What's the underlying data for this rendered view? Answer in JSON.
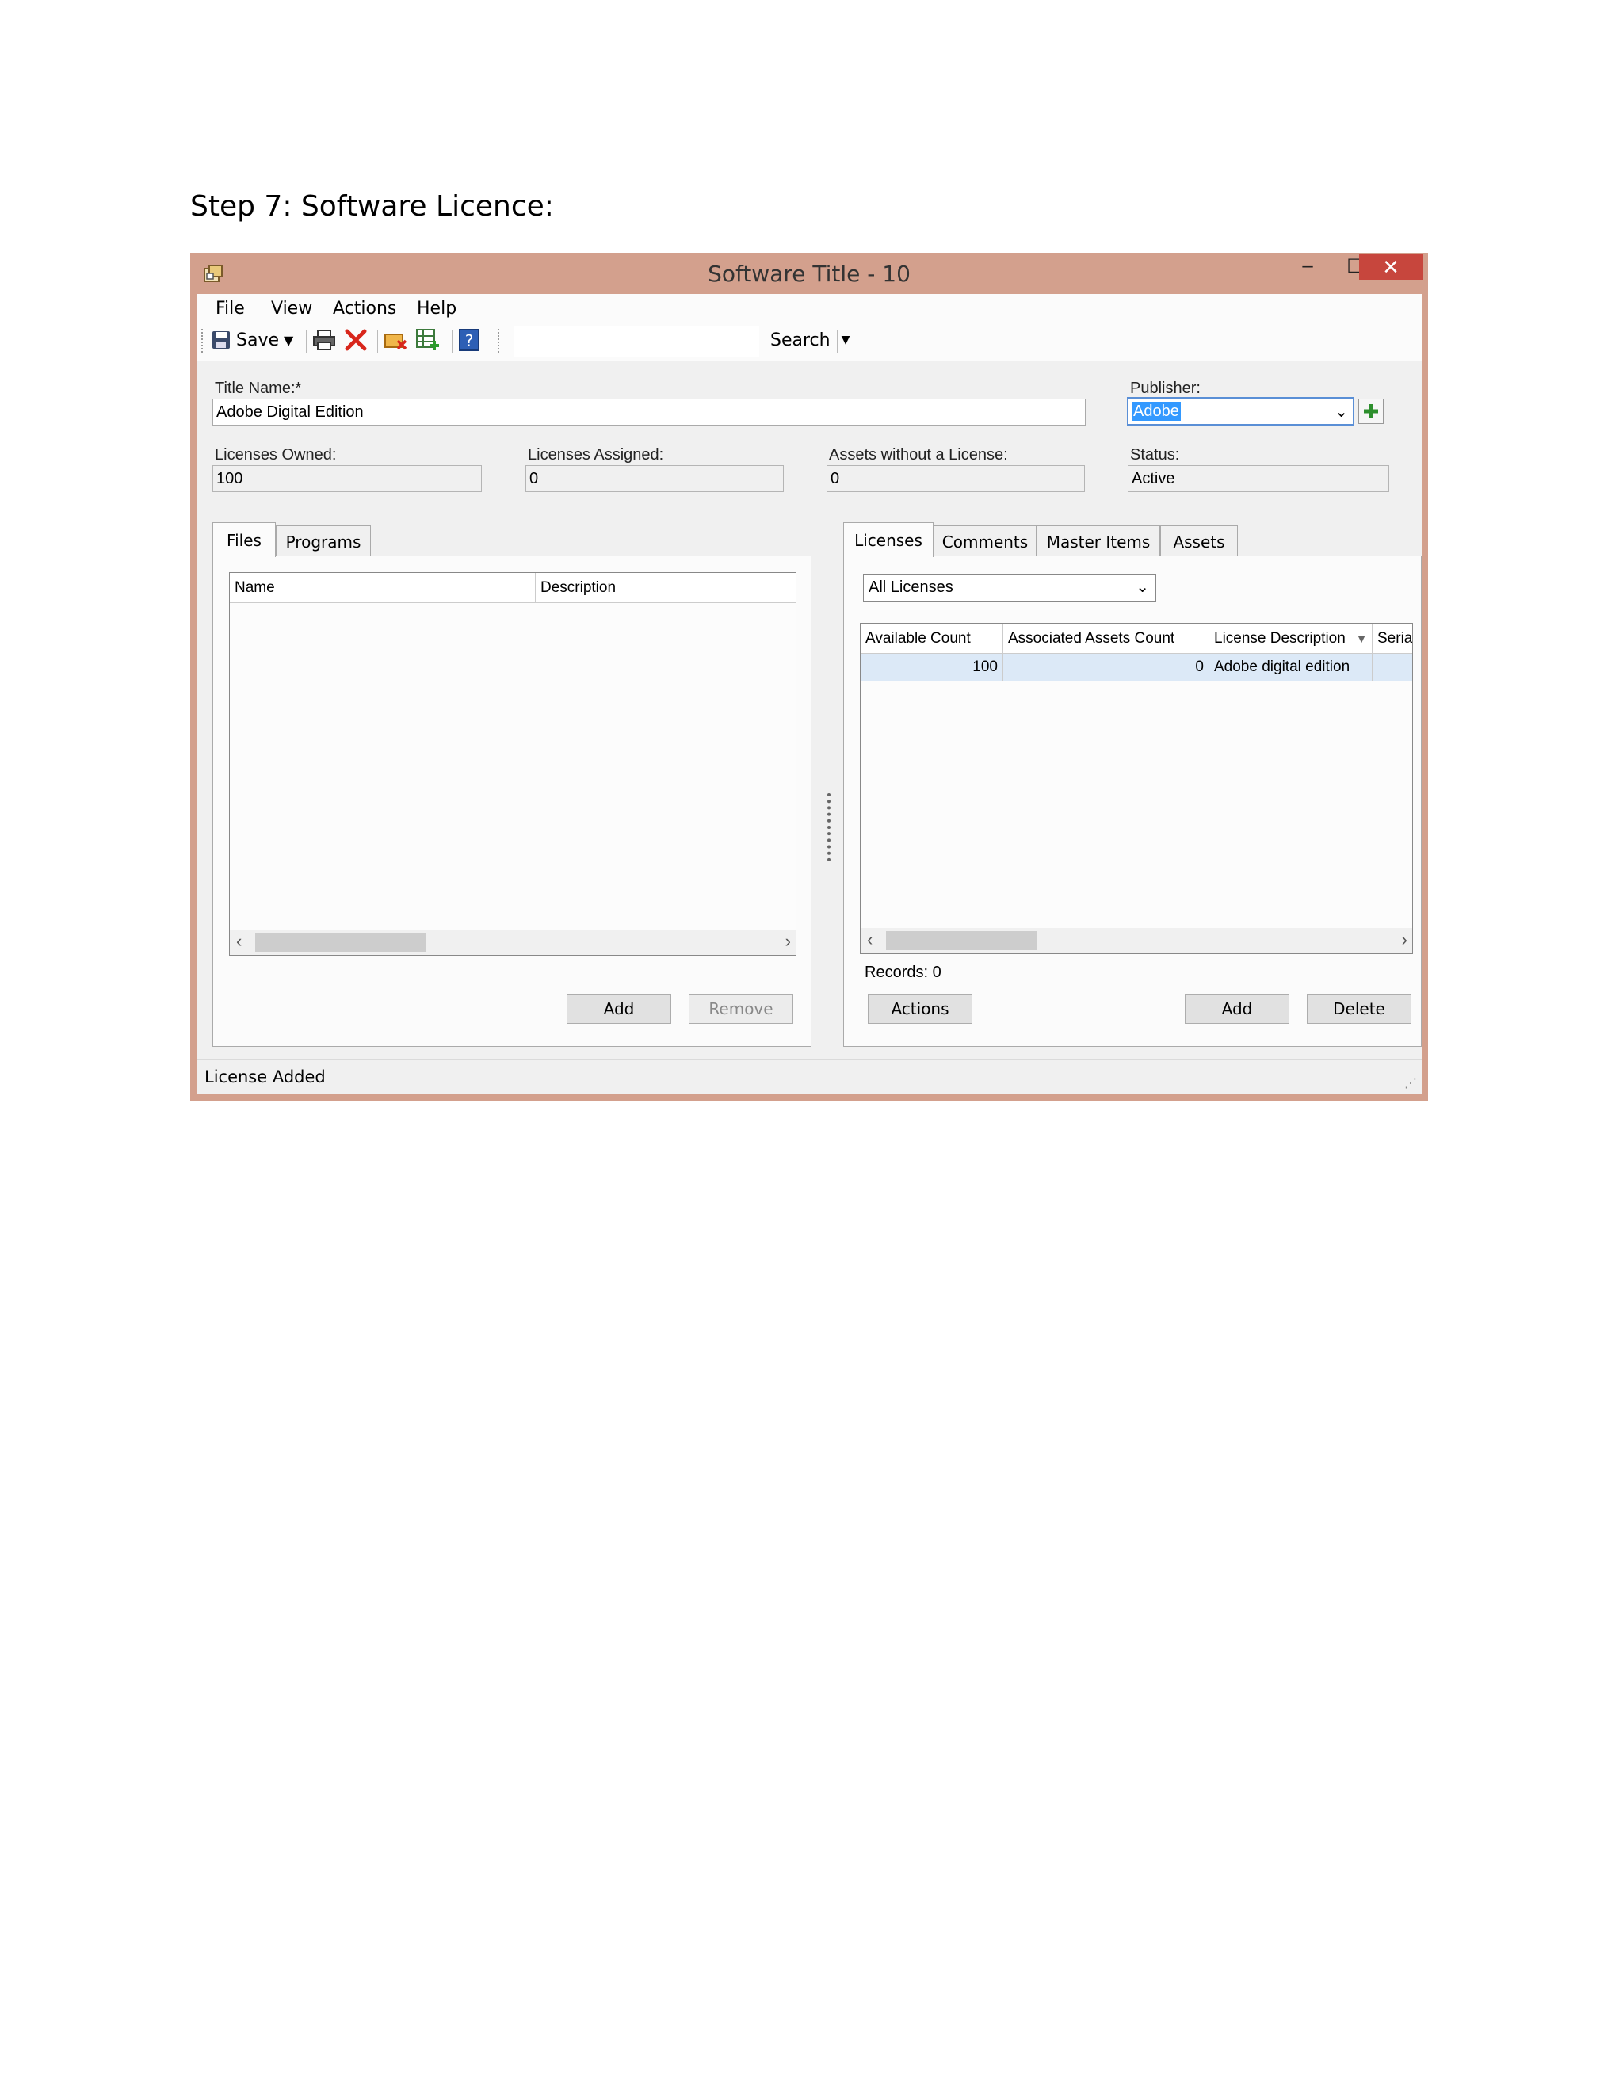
{
  "doc": {
    "heading": "Step 7: Software Licence:"
  },
  "window": {
    "title": "Software Title - 10",
    "controls": {
      "minimize": "–",
      "maximize": "☐",
      "close": "✕"
    }
  },
  "menu": [
    "File",
    "View",
    "Actions",
    "Help"
  ],
  "toolbar": {
    "save": "Save",
    "search": "Search",
    "search_value": ""
  },
  "form": {
    "title_name_label": "Title Name:*",
    "title_name_value": "Adobe Digital Edition",
    "publisher_label": "Publisher:",
    "publisher_value": "Adobe",
    "licenses_owned_label": "Licenses Owned:",
    "licenses_owned_value": "100",
    "licenses_assigned_label": "Licenses Assigned:",
    "licenses_assigned_value": "0",
    "assets_without_label": "Assets without a License:",
    "assets_without_value": "0",
    "status_label": "Status:",
    "status_value": "Active"
  },
  "left_panel": {
    "tabs": [
      "Files",
      "Programs"
    ],
    "columns": [
      "Name",
      "Description"
    ],
    "add_button": "Add",
    "remove_button": "Remove"
  },
  "right_panel": {
    "tabs": [
      "Licenses",
      "Comments",
      "Master Items",
      "Assets"
    ],
    "filter": "All Licenses",
    "columns": [
      "Available Count",
      "Associated Assets Count",
      "License Description",
      "Seria"
    ],
    "rows": [
      {
        "available_count": "100",
        "associated_assets_count": "0",
        "license_description": "Adobe digital edition",
        "serial": ""
      }
    ],
    "records": "Records: 0",
    "actions_button": "Actions",
    "add_button": "Add",
    "delete_button": "Delete"
  },
  "status_bar": {
    "text": "License Added"
  },
  "colors": {
    "window_frame": "#d3a08d",
    "close_button": "#c7463d",
    "selection": "#3399ff",
    "row_highlight": "#dce9f7"
  }
}
